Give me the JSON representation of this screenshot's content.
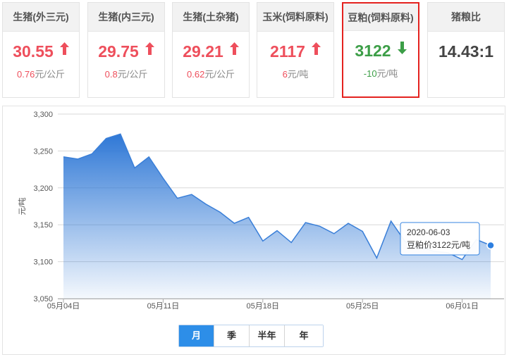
{
  "cards": [
    {
      "title": "生猪(外三元)",
      "price": "30.55",
      "arrow": "up",
      "change_num": "0.76",
      "change_unit": "元/公斤"
    },
    {
      "title": "生猪(内三元)",
      "price": "29.75",
      "arrow": "up",
      "change_num": "0.8",
      "change_unit": "元/公斤"
    },
    {
      "title": "生猪(土杂猪)",
      "price": "29.21",
      "arrow": "up",
      "change_num": "0.62",
      "change_unit": "元/公斤"
    },
    {
      "title": "玉米(饲料原料)",
      "price": "2117",
      "arrow": "up",
      "change_num": "6",
      "change_unit": "元/吨"
    },
    {
      "title": "豆粕(饲料原料)",
      "price": "3122",
      "arrow": "down",
      "change_num": "-10",
      "change_unit": "元/吨"
    },
    {
      "title": "猪粮比",
      "price": "14.43:1",
      "arrow": "none",
      "change_num": "",
      "change_unit": ""
    }
  ],
  "colors": {
    "up": "#ee4f5c",
    "down": "#3c9e47",
    "accent": "#2d8ee8",
    "active_border": "#e4221f"
  },
  "icons": {
    "up": "arrow-up-icon",
    "down": "arrow-down-icon"
  },
  "range_tabs": [
    "月",
    "季",
    "半年",
    "年"
  ],
  "active_tab": "月",
  "tooltip": {
    "date": "2020-06-03",
    "text": "豆粕价3122元/吨"
  },
  "chart_data": {
    "type": "area",
    "ylabel": "元/吨",
    "ylim": [
      3050,
      3300
    ],
    "yticks": [
      3050,
      3100,
      3150,
      3200,
      3250,
      3300
    ],
    "ytick_labels": [
      "3,050",
      "3,100",
      "3,150",
      "3,200",
      "3,250",
      "3,300"
    ],
    "xticks": [
      "2020-05-04",
      "2020-05-11",
      "2020-05-18",
      "2020-05-25",
      "2020-06-01"
    ],
    "xtick_labels": [
      "05月04日",
      "05月11日",
      "05月18日",
      "05月25日",
      "06月01日"
    ],
    "x": [
      "2020-05-04",
      "2020-05-05",
      "2020-05-06",
      "2020-05-07",
      "2020-05-08",
      "2020-05-09",
      "2020-05-10",
      "2020-05-11",
      "2020-05-12",
      "2020-05-13",
      "2020-05-14",
      "2020-05-15",
      "2020-05-16",
      "2020-05-17",
      "2020-05-18",
      "2020-05-19",
      "2020-05-20",
      "2020-05-21",
      "2020-05-22",
      "2020-05-23",
      "2020-05-24",
      "2020-05-25",
      "2020-05-26",
      "2020-05-27",
      "2020-05-28",
      "2020-05-29",
      "2020-05-30",
      "2020-05-31",
      "2020-06-01",
      "2020-06-02",
      "2020-06-03"
    ],
    "values": [
      3242,
      3239,
      3246,
      3267,
      3273,
      3227,
      3242,
      3213,
      3186,
      3191,
      3178,
      3167,
      3152,
      3160,
      3128,
      3142,
      3126,
      3153,
      3148,
      3138,
      3152,
      3141,
      3105,
      3155,
      3127,
      3121,
      3114,
      3112,
      3103,
      3130,
      3122
    ],
    "series_color": "#3a7fd8",
    "grid": true
  }
}
